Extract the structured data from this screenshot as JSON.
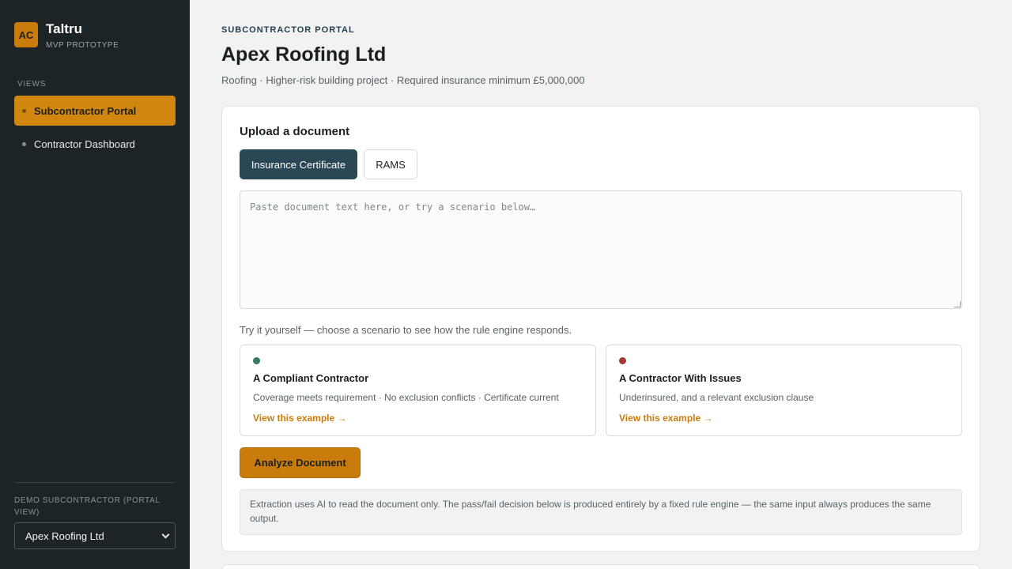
{
  "brand": {
    "logo": "AC",
    "name": "Taltru",
    "subtitle": "MVP PROTOTYPE"
  },
  "sidebar": {
    "views_label": "VIEWS",
    "items": [
      {
        "label": "Subcontractor Portal",
        "active": true
      },
      {
        "label": "Contractor Dashboard",
        "active": false
      }
    ],
    "demo_label": "DEMO SUBCONTRACTOR (PORTAL VIEW)",
    "demo_selected": "Apex Roofing Ltd"
  },
  "header": {
    "eyebrow": "SUBCONTRACTOR PORTAL",
    "title": "Apex Roofing Ltd",
    "subtitle": "Roofing · Higher-risk building project · Required insurance minimum £5,000,000"
  },
  "upload": {
    "title": "Upload a document",
    "tabs": [
      {
        "label": "Insurance Certificate",
        "active": true
      },
      {
        "label": "RAMS",
        "active": false
      }
    ],
    "placeholder": "Paste document text here, or try a scenario below…",
    "value": "",
    "hint": "Try it yourself — choose a scenario to see how the rule engine responds.",
    "scenarios": [
      {
        "title": "A Compliant Contractor",
        "description": "Coverage meets requirement · No exclusion conflicts · Certificate current",
        "link": "View this example →",
        "status_color": "#3b7a5e"
      },
      {
        "title": "A Contractor With Issues",
        "description": "Underinsured, and a relevant exclusion clause",
        "link": "View this example →",
        "status_color": "#a33a34"
      }
    ],
    "analyze_label": "Analyze Document",
    "note": "Extraction uses AI to read the document only. The pass/fail decision below is produced entirely by a fixed rule engine — the same input always produces the same output."
  },
  "colors": {
    "accent": "#c97b0c",
    "primary": "#2a4756",
    "sidebar_bg": "#1d2427"
  }
}
